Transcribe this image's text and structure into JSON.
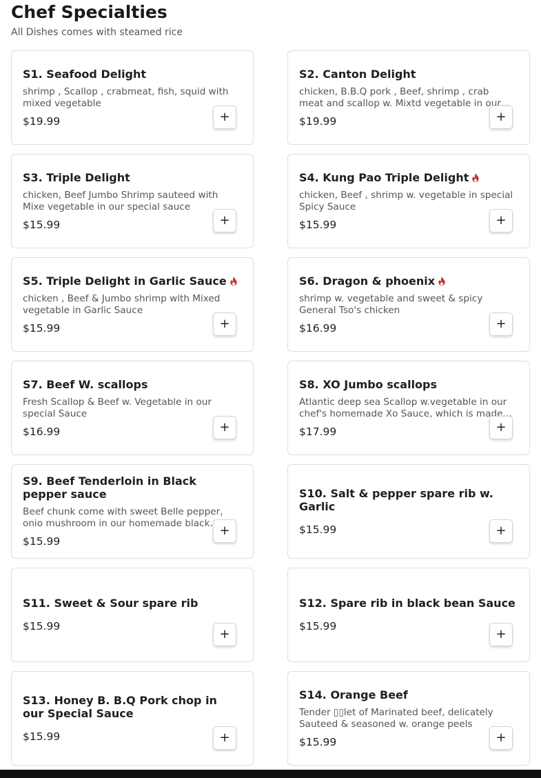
{
  "page": {
    "title": "Chef Specialties",
    "subtitle": "All Dishes comes with steamed rice",
    "spicy_color": "#c0392b",
    "add_label": "+"
  },
  "items": [
    {
      "name": "S1. Seafood Delight",
      "description": "shrimp , Scallop , crabmeat, fish, squid with mixed vegetable",
      "price": "$19.99",
      "spicy": false
    },
    {
      "name": "S2. Canton Delight",
      "description": "chicken, B.B.Q pork , Beef, shrimp , crab meat and scallop w. Mixtd vegetable in our special sauce",
      "price": "$19.99",
      "spicy": false
    },
    {
      "name": "S3. Triple Delight",
      "description": "chicken, Beef Jumbo Shrimp sauteed with Mixe vegetable in our special sauce",
      "price": "$15.99",
      "spicy": false
    },
    {
      "name": "S4. Kung Pao Triple Delight",
      "description": "chicken, Beef , shrimp w. vegetable in special Spicy Sauce",
      "price": "$15.99",
      "spicy": true
    },
    {
      "name": "S5. Triple Delight in Garlic Sauce",
      "description": "chicken , Beef & Jumbo shrimp with Mixed vegetable in Garlic Sauce",
      "price": "$15.99",
      "spicy": true
    },
    {
      "name": "S6. Dragon & phoenix",
      "description": "shrimp w. vegetable and sweet & spicy General Tso's chicken",
      "price": "$16.99",
      "spicy": true
    },
    {
      "name": "S7. Beef W. scallops",
      "description": "Fresh Scallop & Beef w. Vegetable in our special Sauce",
      "price": "$16.99",
      "spicy": false
    },
    {
      "name": "S8. XO Jumbo scallops",
      "description": "Atlantic deep sea Scallop w.vegetable in our chef's homemade Xo Sauce, which is made with dried seafood",
      "price": "$17.99",
      "spicy": false
    },
    {
      "name": "S9. Beef Tenderloin in Black pepper sauce",
      "description": "Beef chunk come with sweet Belle pepper, onio mushroom in our homemade black pepper sauce",
      "price": "$15.99",
      "spicy": false
    },
    {
      "name": "S10. Salt & pepper spare rib w. Garlic",
      "description": "",
      "price": "$15.99",
      "spicy": false
    },
    {
      "name": "S11. Sweet & Sour spare rib",
      "description": "",
      "price": "$15.99",
      "spicy": false
    },
    {
      "name": "S12. Spare rib in black bean Sauce",
      "description": "",
      "price": "$15.99",
      "spicy": false
    },
    {
      "name": "S13. Honey B. B.Q Pork chop in our Special Sauce",
      "description": "",
      "price": "$15.99",
      "spicy": false
    },
    {
      "name": "S14. Orange Beef",
      "description": "Tender ▯▯let of Marinated beef, delicately Sauteed & seasoned w. orange peels",
      "price": "$15.99",
      "spicy": false
    }
  ]
}
